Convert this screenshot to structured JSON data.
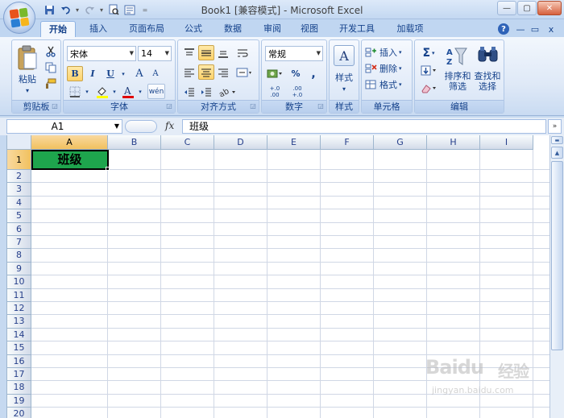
{
  "window": {
    "title": "Book1  [兼容模式] - Microsoft Excel",
    "qat_sep": "=",
    "controls": {
      "minimize": "—",
      "maximize": "▢",
      "close": "✕"
    }
  },
  "ribbon_tabs": [
    {
      "label": "开始",
      "active": true
    },
    {
      "label": "插入"
    },
    {
      "label": "页面布局"
    },
    {
      "label": "公式"
    },
    {
      "label": "数据"
    },
    {
      "label": "审阅"
    },
    {
      "label": "视图"
    },
    {
      "label": "开发工具"
    },
    {
      "label": "加载项"
    }
  ],
  "ribbon_right": {
    "help": "?",
    "minimize": "—",
    "restore": "▭",
    "close": "x"
  },
  "groups": {
    "clipboard": {
      "label": "剪贴板",
      "paste": "粘贴",
      "paste_arrow": "▾"
    },
    "font": {
      "label": "字体",
      "name": "宋体",
      "size": "14",
      "bold": "B",
      "italic": "I",
      "underline": "U",
      "grow": "A",
      "shrink": "A",
      "phonetic": "wén"
    },
    "alignment": {
      "label": "对齐方式"
    },
    "number": {
      "label": "数字",
      "format": "常规",
      "percent": "%",
      "comma": ",",
      "inc_decimal": "+.0 .00",
      "dec_decimal": ".00 +.0"
    },
    "styles": {
      "label": "样式",
      "styles_btn": "样式"
    },
    "cells": {
      "label": "单元格",
      "insert": "插入",
      "delete": "删除",
      "format": "格式"
    },
    "editing": {
      "label": "编辑",
      "sum": "Σ",
      "sort": "排序和\n筛选",
      "find": "查找和\n选择"
    }
  },
  "formula_bar": {
    "name_box": "A1",
    "fx": "fx",
    "expand": "»",
    "content": "班级"
  },
  "sheet": {
    "columns": [
      "A",
      "B",
      "C",
      "D",
      "E",
      "F",
      "G",
      "H",
      "I"
    ],
    "rows": [
      "1",
      "2",
      "3",
      "4",
      "5",
      "6",
      "7",
      "8",
      "9",
      "10",
      "11",
      "12",
      "13",
      "14",
      "15",
      "16",
      "17",
      "18",
      "19",
      "20"
    ],
    "selected_cell": "A1",
    "cells": {
      "A1": "班级"
    },
    "a1_fill": "#1ea54d"
  },
  "watermark": {
    "brand": "Baidu",
    "brand2": "经验",
    "url": "jingyan.baidu.com"
  }
}
